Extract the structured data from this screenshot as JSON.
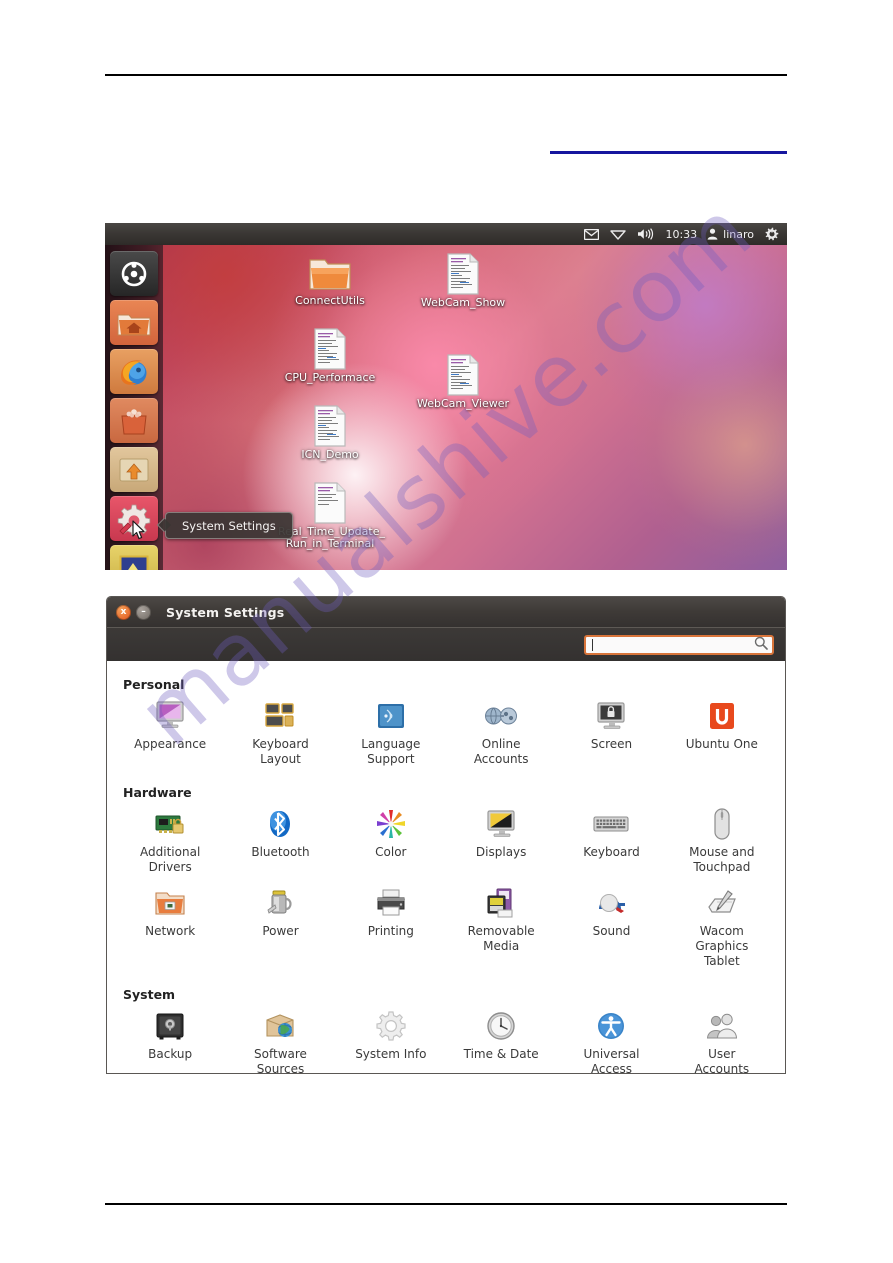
{
  "page": {
    "rules": {
      "top": true,
      "blue_accent": true,
      "bottom": true
    },
    "watermark": "manualshive.com",
    "accent_blue": "#16169e"
  },
  "desktop": {
    "panel": {
      "indicators": [
        {
          "name": "messaging-icon",
          "glyph": "envelope"
        },
        {
          "name": "network-icon",
          "glyph": "wifi"
        },
        {
          "name": "volume-icon",
          "glyph": "speaker"
        }
      ],
      "clock": "10:33",
      "user": "linaro",
      "session_icon": "power-gear"
    },
    "launcher": {
      "items": [
        {
          "name": "dash-home",
          "label": "Dash Home"
        },
        {
          "name": "home-folder",
          "label": "Home Folder"
        },
        {
          "name": "firefox",
          "label": "Firefox Web Browser"
        },
        {
          "name": "software-center",
          "label": "Ubuntu Software Center"
        },
        {
          "name": "update-manager",
          "label": "Update Manager"
        },
        {
          "name": "system-settings",
          "label": "System Settings"
        },
        {
          "name": "media-player",
          "label": "Media Player"
        }
      ]
    },
    "icons": [
      {
        "label": "ConnectUtils",
        "type": "folder"
      },
      {
        "label": "WebCam_Show",
        "type": "document"
      },
      {
        "label": "CPU_Performace",
        "type": "document"
      },
      {
        "label": "WebCam_Viewer",
        "type": "document"
      },
      {
        "label": "ICN_Demo",
        "type": "document"
      },
      {
        "label": "Real_Time_Update_\nRun_in_Terminal",
        "type": "document"
      }
    ],
    "tooltip": "System Settings"
  },
  "settings_window": {
    "title": "System Settings",
    "close_label": "x",
    "minimize_label": "–",
    "search": {
      "value": "",
      "placeholder": ""
    },
    "sections": [
      {
        "title": "Personal",
        "items": [
          {
            "label": "Appearance",
            "icon": "appearance-icon"
          },
          {
            "label": "Keyboard\nLayout",
            "icon": "keyboard-layout-icon"
          },
          {
            "label": "Language\nSupport",
            "icon": "language-support-icon"
          },
          {
            "label": "Online\nAccounts",
            "icon": "online-accounts-icon"
          },
          {
            "label": "Screen",
            "icon": "screen-lock-icon"
          },
          {
            "label": "Ubuntu One",
            "icon": "ubuntu-one-icon"
          }
        ]
      },
      {
        "title": "Hardware",
        "items": [
          {
            "label": "Additional\nDrivers",
            "icon": "additional-drivers-icon"
          },
          {
            "label": "Bluetooth",
            "icon": "bluetooth-icon"
          },
          {
            "label": "Color",
            "icon": "color-icon"
          },
          {
            "label": "Displays",
            "icon": "displays-icon"
          },
          {
            "label": "Keyboard",
            "icon": "keyboard-icon"
          },
          {
            "label": "Mouse and\nTouchpad",
            "icon": "mouse-icon"
          },
          {
            "label": "Network",
            "icon": "network-icon"
          },
          {
            "label": "Power",
            "icon": "power-icon"
          },
          {
            "label": "Printing",
            "icon": "printer-icon"
          },
          {
            "label": "Removable\nMedia",
            "icon": "removable-media-icon"
          },
          {
            "label": "Sound",
            "icon": "sound-icon"
          },
          {
            "label": "Wacom\nGraphics\nTablet",
            "icon": "wacom-tablet-icon"
          }
        ]
      },
      {
        "title": "System",
        "items": [
          {
            "label": "Backup",
            "icon": "backup-safe-icon"
          },
          {
            "label": "Software\nSources",
            "icon": "software-sources-icon"
          },
          {
            "label": "System Info",
            "icon": "system-info-gear-icon"
          },
          {
            "label": "Time & Date",
            "icon": "clock-icon"
          },
          {
            "label": "Universal\nAccess",
            "icon": "universal-access-icon"
          },
          {
            "label": "User\nAccounts",
            "icon": "user-accounts-icon"
          }
        ]
      }
    ]
  }
}
